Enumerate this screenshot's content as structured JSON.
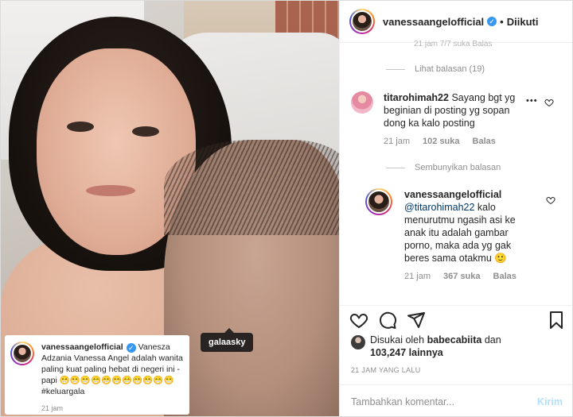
{
  "post": {
    "username": "vanessaangelofficial",
    "follow_status": "Diikuti",
    "dot": "•",
    "photo_tag": "galaasky",
    "caption": {
      "username": "vanessaangelofficial",
      "text": "Vanesza Adzania Vanessa Angel adalah wanita paling kuat paling hebat di negeri ini - papi 😁😁😁😁😁😁😁😁😁😁😁 #keluargala",
      "time": "21 jam"
    }
  },
  "comments": {
    "cut_line": "21 jam    7/7 suka    Balas",
    "view_replies": "Lihat balasan (19)",
    "comment1": {
      "username": "titarohimah22",
      "text": "Sayang bgt yg beginian di posting yg sopan dong ka kalo posting",
      "time": "21 jam",
      "likes": "102 suka",
      "reply": "Balas",
      "more": "•••"
    },
    "hide_replies": "Sembunyikan balasan",
    "reply1": {
      "username": "vanessaangelofficial",
      "mention": "@titarohimah22",
      "text": "kalo menurutmu ngasih asi ke anak itu adalah gambar porno, maka ada yg gak beres sama otakmu 🙂",
      "time": "21 jam",
      "likes": "367 suka",
      "reply": "Balas"
    }
  },
  "footer": {
    "liked_by_prefix": "Disukai oleh",
    "liked_by_user": "babecabiita",
    "liked_by_conj": "dan",
    "liked_by_count": "103,247 lainnya",
    "timestamp": "21 JAM YANG LALU",
    "comment_placeholder": "Tambahkan komentar...",
    "post_label": "Kirim"
  },
  "icons": {
    "verified": "✓",
    "like": "heart-icon",
    "comment": "comment-icon",
    "share": "paper-plane-icon",
    "save": "bookmark-icon"
  }
}
